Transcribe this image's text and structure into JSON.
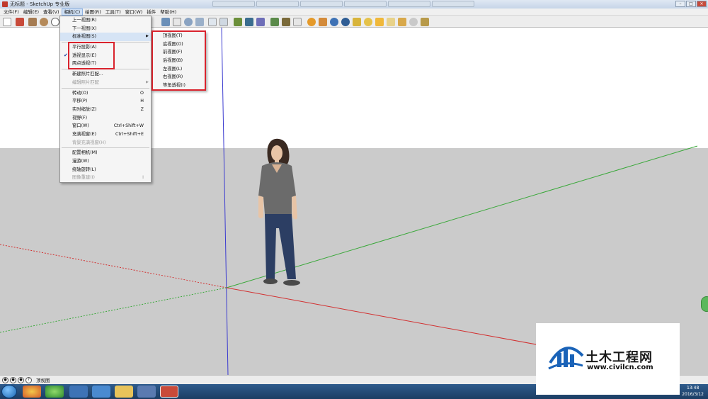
{
  "window": {
    "title": "无标题 - SketchUp 专业版",
    "controls": [
      "–",
      "□",
      "×"
    ]
  },
  "menubar": {
    "items": [
      "文件(F)",
      "编辑(E)",
      "查看(V)",
      "相机(C)",
      "绘图(R)",
      "工具(T)",
      "窗口(W)",
      "插件",
      "帮助(H)"
    ],
    "active_index": 3
  },
  "camera_menu": {
    "items": [
      {
        "label": "上一视图(R)",
        "shortcut": "",
        "disabled": false
      },
      {
        "label": "下一视图(X)",
        "shortcut": "",
        "disabled": false
      },
      {
        "label": "标准视图(S)",
        "shortcut": "",
        "disabled": false,
        "submenu": true,
        "highlight": true
      },
      {
        "sep": true
      },
      {
        "label": "平行投影(A)",
        "shortcut": "",
        "disabled": false
      },
      {
        "label": "透视显示(E)",
        "shortcut": "",
        "disabled": false,
        "checked": true
      },
      {
        "label": "两点透视(T)",
        "shortcut": "",
        "disabled": false
      },
      {
        "sep": true
      },
      {
        "label": "新建照片匹配...",
        "shortcut": "",
        "disabled": false
      },
      {
        "label": "编辑照片匹配",
        "shortcut": "",
        "disabled": true,
        "submenu": true
      },
      {
        "sep": true
      },
      {
        "label": "转动(O)",
        "shortcut": "O",
        "disabled": false
      },
      {
        "label": "平移(P)",
        "shortcut": "H",
        "disabled": false
      },
      {
        "label": "实时缩放(Z)",
        "shortcut": "Z",
        "disabled": false
      },
      {
        "label": "视野(F)",
        "shortcut": "",
        "disabled": false
      },
      {
        "label": "窗口(W)",
        "shortcut": "Ctrl+Shift+W",
        "disabled": false
      },
      {
        "label": "充满视窗(E)",
        "shortcut": "Ctrl+Shift+E",
        "disabled": false
      },
      {
        "label": "背景充满视窗(H)",
        "shortcut": "",
        "disabled": true
      },
      {
        "sep": true
      },
      {
        "label": "配置相机(M)",
        "shortcut": "",
        "disabled": false
      },
      {
        "label": "漫游(W)",
        "shortcut": "",
        "disabled": false
      },
      {
        "label": "绕轴旋转(L)",
        "shortcut": "",
        "disabled": false
      },
      {
        "label": "图像重建(I)",
        "shortcut": "I",
        "disabled": true
      }
    ]
  },
  "standard_views_submenu": {
    "items": [
      "顶视图(T)",
      "底视图(O)",
      "前视图(F)",
      "后视图(B)",
      "左视图(L)",
      "右视图(R)",
      "等角透视(I)"
    ]
  },
  "statusbar": {
    "text": "顶视图"
  },
  "taskbar": {
    "time": "13:48",
    "date": "2016/3/12"
  },
  "watermark": {
    "title": "土木工程网",
    "url": "www.civilcn.com"
  },
  "colors": {
    "highlight_box": "#d9232d",
    "axis_red": "#d23030",
    "axis_green": "#3aa83a",
    "axis_blue": "#3b3bd0"
  }
}
